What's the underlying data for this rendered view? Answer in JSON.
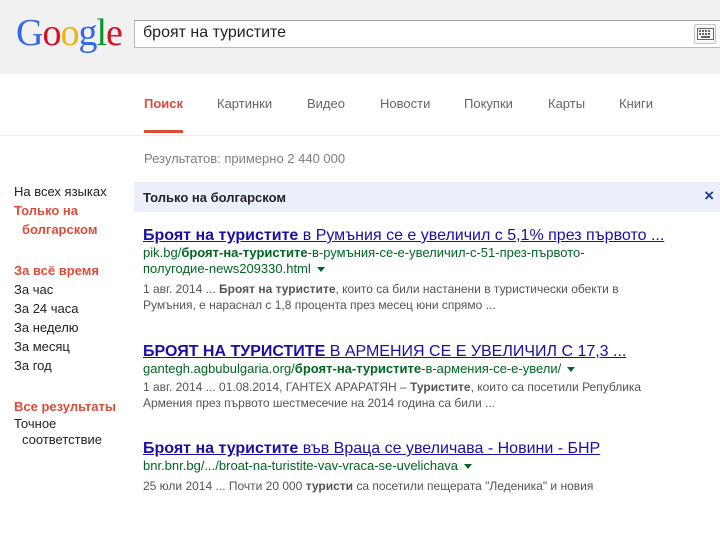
{
  "logo": {
    "letters": [
      "G",
      "o",
      "o",
      "g",
      "l",
      "e"
    ],
    "colors": [
      "#3369e8",
      "#d50f25",
      "#eeb211",
      "#3369e8",
      "#009925",
      "#d50f25"
    ]
  },
  "search": {
    "query": "броят на туристите"
  },
  "tabs": [
    "Поиск",
    "Картинки",
    "Видео",
    "Новости",
    "Покупки",
    "Карты",
    "Книги"
  ],
  "stats": "Результатов: примерно 2 440 000",
  "sidebar": {
    "lang_all": "На всех языках",
    "lang_bg_1": "Только на",
    "lang_bg_2": "болгарском",
    "time_header": "За всё время",
    "time_items": [
      "За час",
      "За 24 часа",
      "За неделю",
      "За месяц",
      "За год"
    ],
    "results_header": "Все результаты",
    "exact_1": "Точное",
    "exact_2": "соответствие"
  },
  "notice": {
    "label": "Только на болгарском",
    "close": "×"
  },
  "results": [
    {
      "title_bold": "Броят на туристите",
      "title_rest": " в Румъния се е увеличил с 5,1% през първото ...",
      "url_pre": "pik.bg/",
      "url_bold": "броят-на-туристите",
      "url_post": "-в-румъния-се-е-увеличил-с-51-през-първото-",
      "url_line2": "полугодие-news209330.html",
      "s1_date": "1 авг. 2014 ... ",
      "s1_bold": "Броят на туристите",
      "s1_rest": ", които са били настанени в туристически обекти в",
      "s2": "Румъния, е нараснал с 1,8 процента през месец юни спрямо ..."
    },
    {
      "title_bold": "БРОЯТ НА ТУРИСТИТЕ",
      "title_rest": " В АРМЕНИЯ СЕ Е УВЕЛИЧИЛ С 17,3 ...",
      "url_pre": "gantegh.agbubulgaria.org/",
      "url_bold": "броят-на-туристите",
      "url_post": "-в-армения-се-е-увели/",
      "s1_date": "1 авг. 2014 ... ",
      "s1_mid": "01.08.2014, ГАНТЕХ АРАРАТЯН – ",
      "s1_bold": "Туристите",
      "s1_rest": ", които са посетили Република",
      "s2": "Армения през първото шестмесечие на 2014 година са били ..."
    },
    {
      "title_bold": "Броят на туристите",
      "title_rest": " във Враца се увеличава - Новини - БНР",
      "url_pre": "bnr.bnr.bg/.../broat-na-turistite-vav-vraca-se-uvelichava",
      "s1_date": "25 юли 2014 ... ",
      "s1_pre": "Почти 20 000 ",
      "s1_bold": "туристи",
      "s1_rest": " са посетили пещерата \"Леденика\" и новия"
    }
  ]
}
